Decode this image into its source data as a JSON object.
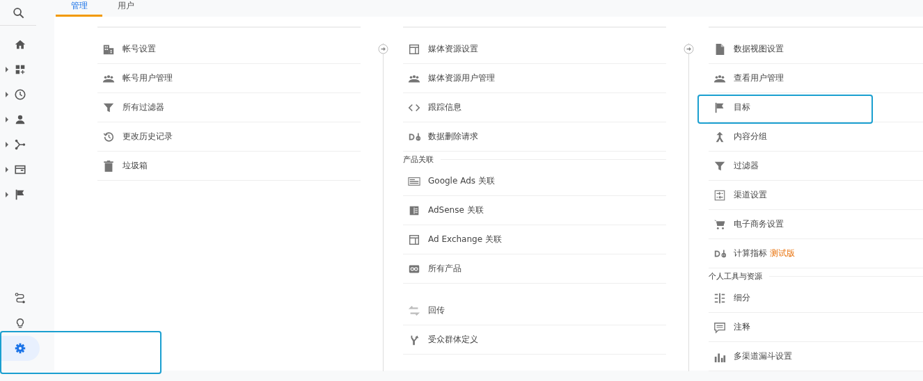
{
  "sidebar": {
    "items": [
      {
        "expandable": false,
        "selected": false
      },
      {
        "expandable": true,
        "selected": false
      },
      {
        "expandable": true,
        "selected": false
      },
      {
        "expandable": true,
        "selected": false
      },
      {
        "expandable": true,
        "selected": false
      },
      {
        "expandable": true,
        "selected": false
      },
      {
        "expandable": true,
        "selected": false
      }
    ],
    "bottom_items": [
      {
        "selected": false
      },
      {
        "selected": false
      },
      {
        "selected": true
      }
    ],
    "bottom_highlighted": true
  },
  "tabs": [
    {
      "label": "管理",
      "selected": true
    },
    {
      "label": "用户",
      "selected": false
    }
  ],
  "columns": [
    {
      "items": [
        {
          "kind": "item",
          "label": "帐号设置",
          "highlighted": false
        },
        {
          "kind": "item",
          "label": "帐号用户管理",
          "highlighted": false
        },
        {
          "kind": "item",
          "label": "所有过滤器",
          "highlighted": false
        },
        {
          "kind": "item",
          "label": "更改历史记录",
          "highlighted": false
        },
        {
          "kind": "item",
          "label": "垃圾箱",
          "highlighted": false
        }
      ]
    },
    {
      "items": [
        {
          "kind": "item",
          "label": "媒体资源设置",
          "highlighted": false
        },
        {
          "kind": "item",
          "label": "媒体资源用户管理",
          "highlighted": false
        },
        {
          "kind": "item",
          "label": "跟踪信息",
          "highlighted": false
        },
        {
          "kind": "item",
          "label": "数据删除请求",
          "highlighted": false
        },
        {
          "kind": "heading",
          "label": "产品关联"
        },
        {
          "kind": "item",
          "label": "Google Ads 关联",
          "highlighted": false
        },
        {
          "kind": "item",
          "label": "AdSense 关联",
          "highlighted": false
        },
        {
          "kind": "item",
          "label": "Ad Exchange 关联",
          "highlighted": false
        },
        {
          "kind": "item",
          "label": "所有产品",
          "highlighted": false
        },
        {
          "kind": "spacer"
        },
        {
          "kind": "item",
          "label": "回传",
          "highlighted": false
        },
        {
          "kind": "item",
          "label": "受众群体定义",
          "highlighted": false
        }
      ]
    },
    {
      "items": [
        {
          "kind": "item",
          "label": "数据视图设置",
          "highlighted": false
        },
        {
          "kind": "item",
          "label": "查看用户管理",
          "highlighted": false
        },
        {
          "kind": "item",
          "label": "目标",
          "highlighted": true
        },
        {
          "kind": "item",
          "label": "内容分组",
          "highlighted": false
        },
        {
          "kind": "item",
          "label": "过滤器",
          "highlighted": false
        },
        {
          "kind": "item",
          "label": "渠道设置",
          "highlighted": false
        },
        {
          "kind": "item",
          "label": "电子商务设置",
          "highlighted": false
        },
        {
          "kind": "item",
          "label": "计算指标",
          "badge": "测试版",
          "highlighted": false
        },
        {
          "kind": "heading",
          "label": "个人工具与资源"
        },
        {
          "kind": "item",
          "label": "细分",
          "highlighted": false
        },
        {
          "kind": "item",
          "label": "注释",
          "highlighted": false
        },
        {
          "kind": "item",
          "label": "多渠道漏斗设置",
          "highlighted": false
        }
      ]
    }
  ]
}
